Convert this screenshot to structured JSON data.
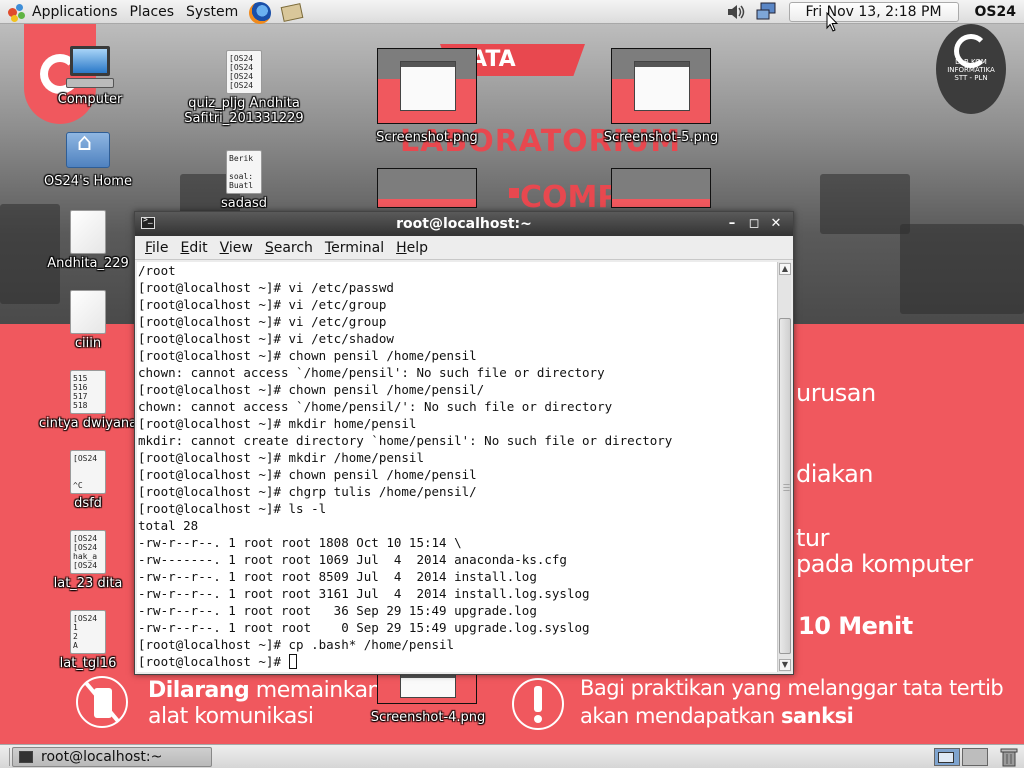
{
  "top_panel": {
    "menus": [
      "Applications",
      "Places",
      "System"
    ],
    "clock": "Fri Nov 13,  2:18 PM",
    "user": "OS24"
  },
  "desktop_icons": [
    {
      "label": "Computer",
      "kind": "computer"
    },
    {
      "label": "quiz_pljg Andhita Safitri_201331229",
      "kind": "file",
      "preview": "[OS24\n[OS24\n[OS24\n[OS24"
    },
    {
      "label": "OS24's Home",
      "kind": "folder"
    },
    {
      "label": "sadasd",
      "kind": "file",
      "preview": "Berik\n\nsoal:\nBuatl"
    },
    {
      "label": "Andhita_229",
      "kind": "blank"
    },
    {
      "label": "ciiin",
      "kind": "blank"
    },
    {
      "label": "cintya dwiyana",
      "kind": "file",
      "preview": "515\n516\n517\n518"
    },
    {
      "label": "dsfd",
      "kind": "file",
      "preview": "[OS24\n\n\n^C"
    },
    {
      "label": "lat_23 dita",
      "kind": "file",
      "preview": "[OS24\n[OS24\nhak_a\n[OS24"
    },
    {
      "label": "lat_tgl16",
      "kind": "file",
      "preview": "[OS24\n1\n2\nA"
    }
  ],
  "screenshot_thumbs": [
    {
      "label": "Screenshot.png"
    },
    {
      "label": "Screenshot-5.png"
    },
    {
      "label": "Screenshot-4.png"
    }
  ],
  "wallpaper": {
    "banner": "ATA TERTIB",
    "heading": "LABORATORIUM",
    "heading2": "COMP",
    "rules_right": [
      "urusan",
      "diakan",
      "tur",
      "pada komputer",
      "10 Menit"
    ],
    "rule_phone_bold": "Dilarang",
    "rule_phone_rest": " memainkan",
    "rule_phone_line2": "alat komunikasi",
    "rule_sanction_line1": "Bagi praktikan yang melanggar tata tertib",
    "rule_sanction_line2a": "akan mendapatkan ",
    "rule_sanction_line2b": "sanksi",
    "logo_right_line1": "LAB KOM",
    "logo_right_line2": "INFORMATIKA",
    "logo_right_line3": "STT - PLN"
  },
  "terminal": {
    "title": "root@localhost:~",
    "menu": [
      {
        "ul": "F",
        "rest": "ile"
      },
      {
        "ul": "E",
        "rest": "dit"
      },
      {
        "ul": "V",
        "rest": "iew"
      },
      {
        "ul": "S",
        "rest": "earch"
      },
      {
        "ul": "T",
        "rest": "erminal"
      },
      {
        "ul": "H",
        "rest": "elp"
      }
    ],
    "lines": [
      "/root",
      "[root@localhost ~]# vi /etc/passwd",
      "[root@localhost ~]# vi /etc/group",
      "[root@localhost ~]# vi /etc/group",
      "[root@localhost ~]# vi /etc/shadow",
      "[root@localhost ~]# chown pensil /home/pensil",
      "chown: cannot access `/home/pensil': No such file or directory",
      "[root@localhost ~]# chown pensil /home/pensil/",
      "chown: cannot access `/home/pensil/': No such file or directory",
      "[root@localhost ~]# mkdir home/pensil",
      "mkdir: cannot create directory `home/pensil': No such file or directory",
      "[root@localhost ~]# mkdir /home/pensil",
      "[root@localhost ~]# chown pensil /home/pensil",
      "[root@localhost ~]# chgrp tulis /home/pensil/",
      "[root@localhost ~]# ls -l",
      "total 28",
      "-rw-r--r--. 1 root root 1808 Oct 10 15:14 \\",
      "-rw-------. 1 root root 1069 Jul  4  2014 anaconda-ks.cfg",
      "-rw-r--r--. 1 root root 8509 Jul  4  2014 install.log",
      "-rw-r--r--. 1 root root 3161 Jul  4  2014 install.log.syslog",
      "-rw-r--r--. 1 root root   36 Sep 29 15:49 upgrade.log",
      "-rw-r--r--. 1 root root    0 Sep 29 15:49 upgrade.log.syslog",
      "[root@localhost ~]# cp .bash* /home/pensil"
    ],
    "prompt": "[root@localhost ~]# "
  },
  "taskbar": {
    "task_label": "root@localhost:~"
  }
}
